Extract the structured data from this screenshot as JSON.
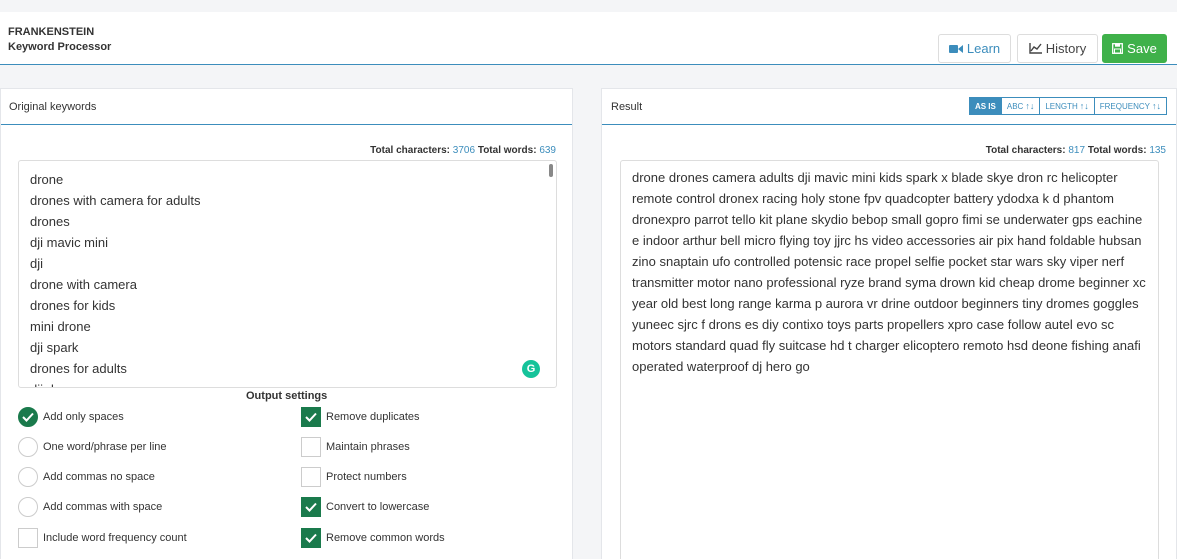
{
  "header": {
    "app_name": "FRANKENSTEIN",
    "app_subtitle": "Keyword Processor",
    "buttons": {
      "learn": "Learn",
      "history": "History",
      "save": "Save"
    }
  },
  "left_panel": {
    "title": "Original keywords",
    "stats": {
      "chars_label": "Total characters:",
      "chars": "3706",
      "words_label": "Total words:",
      "words": "639"
    },
    "keywords": [
      "drone",
      "drones with camera for adults",
      "drones",
      "dji mavic mini",
      "dji",
      "drone with camera",
      "drones for kids",
      "mini drone",
      "dji spark",
      "drones for adults",
      "dji drone"
    ],
    "grammarly_letter": "G"
  },
  "output_settings": {
    "title": "Output settings",
    "radio_options": [
      {
        "label": "Add only spaces",
        "selected": true
      },
      {
        "label": "One word/phrase per line",
        "selected": false
      },
      {
        "label": "Add commas no space",
        "selected": false
      },
      {
        "label": "Add commas with space",
        "selected": false
      }
    ],
    "include_frequency": {
      "label": "Include word frequency count",
      "checked": false
    },
    "checkbox_options": [
      {
        "label": "Remove duplicates",
        "checked": true
      },
      {
        "label": "Maintain phrases",
        "checked": false
      },
      {
        "label": "Protect numbers",
        "checked": false
      },
      {
        "label": "Convert to lowercase",
        "checked": true
      },
      {
        "label": "Remove common words",
        "checked": true
      }
    ]
  },
  "right_panel": {
    "title": "Result",
    "sort_buttons": [
      {
        "label": "AS IS",
        "active": true,
        "arrows": ""
      },
      {
        "label": "ABC",
        "active": false,
        "arrows": "↑↓"
      },
      {
        "label": "LENGTH",
        "active": false,
        "arrows": "↑↓"
      },
      {
        "label": "FREQUENCY",
        "active": false,
        "arrows": "↑↓"
      }
    ],
    "stats": {
      "chars_label": "Total characters:",
      "chars": "817",
      "words_label": "Total words:",
      "words": "135"
    },
    "result_text": "drone drones camera adults dji mavic mini kids spark x blade skye dron rc helicopter remote control dronex racing holy stone fpv quadcopter battery ydodxa k d phantom dronexpro parrot tello kit plane skydio bebop small gopro fimi se underwater gps eachine e indoor arthur bell micro flying toy jjrc hs video accessories air pix hand foldable hubsan zino snaptain ufo controlled potensic race propel selfie pocket star wars sky viper nerf transmitter motor nano professional ryze brand syma drown kid cheap drome beginner xc year old best long range karma p aurora vr drine outdoor beginners tiny dromes goggles yuneec sjrc f drons es diy contixo toys parts propellers xpro case follow autel evo sc motors standard quad fly suitcase hd t charger elicoptero remoto hsd deone fishing anafi operated waterproof dj hero go"
  },
  "colors": {
    "accent": "#3c8dbc",
    "save_green": "#3fb14a",
    "check_green": "#1a7a4c",
    "grammarly": "#15c39a"
  }
}
